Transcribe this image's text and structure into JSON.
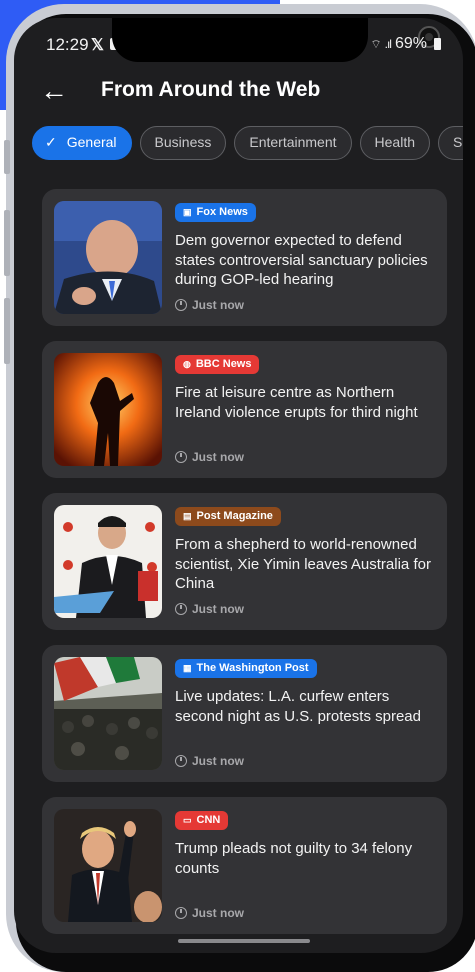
{
  "status_bar": {
    "time": "12:29",
    "battery": "69%"
  },
  "header": {
    "title": "From Around the Web"
  },
  "chips": [
    {
      "label": "General",
      "active": true
    },
    {
      "label": "Business",
      "active": false
    },
    {
      "label": "Entertainment",
      "active": false
    },
    {
      "label": "Health",
      "active": false
    },
    {
      "label": "Sci",
      "active": false
    }
  ],
  "articles": [
    {
      "source": "Fox News",
      "source_color": "#1a73e8",
      "source_icon": "tv-icon",
      "headline": "Dem governor expected to defend states controversial sanctuary policies during GOP-led hearing",
      "time": "Just now"
    },
    {
      "source": "BBC News",
      "source_color": "#e53935",
      "source_icon": "globe-icon",
      "headline": "Fire at leisure centre as Northern Ireland violence erupts for third night",
      "time": "Just now"
    },
    {
      "source": "Post Magazine",
      "source_color": "#8d4a1c",
      "source_icon": "magazine-icon",
      "headline": "From a shepherd to world-renowned scientist, Xie Yimin leaves Australia for China",
      "time": "Just now"
    },
    {
      "source": "The Washington Post",
      "source_color": "#1a73e8",
      "source_icon": "newspaper-icon",
      "headline": "Live updates: L.A. curfew enters second night as U.S. protests spread",
      "time": "Just now"
    },
    {
      "source": "CNN",
      "source_color": "#e53935",
      "source_icon": "tv-icon",
      "headline": "Trump pleads not guilty to 34 felony counts",
      "time": "Just now"
    }
  ]
}
